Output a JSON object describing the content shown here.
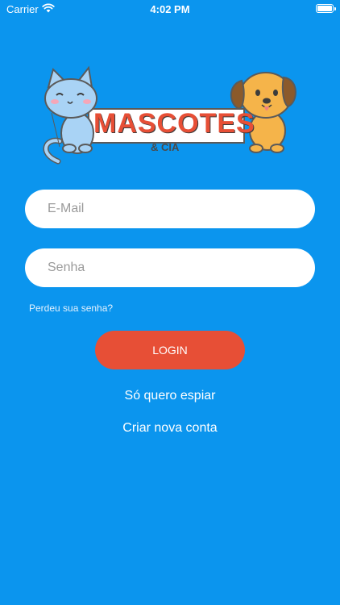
{
  "status_bar": {
    "carrier": "Carrier",
    "time": "4:02 PM",
    "battery_level": 1.0
  },
  "logo": {
    "title": "MASCOTES",
    "subtitle": "& CIA",
    "icons": [
      "cat-icon",
      "dog-icon"
    ]
  },
  "form": {
    "email_placeholder": "E-Mail",
    "password_placeholder": "Senha",
    "forgot_password": "Perdeu sua senha?",
    "login_label": "LOGIN"
  },
  "links": {
    "spy": "Só quero espiar",
    "create_account": "Criar nova conta"
  },
  "colors": {
    "background": "#0b95ee",
    "accent": "#e74f36",
    "text_light": "#ffffff"
  }
}
